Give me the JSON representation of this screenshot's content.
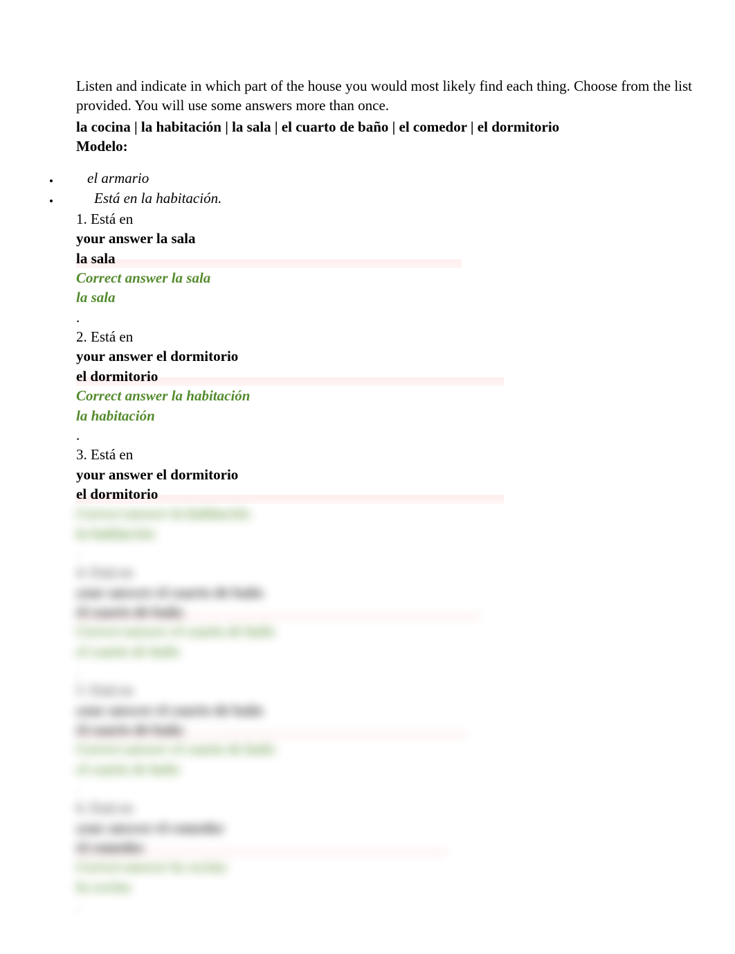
{
  "instructions": "Listen and indicate in which part of the house you would most likely find each thing. Choose from the list provided. You will use some answers more than once.",
  "word_bank": "la cocina | la habitación | la sala | el cuarto de baño | el comedor | el dormitorio",
  "modelo_label": "Modelo:",
  "modelo": {
    "item": "el armario",
    "answer": "Está en la habitación."
  },
  "labels": {
    "your_answer": "your answer",
    "correct_answer": "Correct answer"
  },
  "questions": [
    {
      "num": "1",
      "prompt": "Está en",
      "your_answer": "la sala",
      "correct_answer": "la sala",
      "period": "."
    },
    {
      "num": "2",
      "prompt": "Está en",
      "your_answer": "el dormitorio",
      "correct_answer": "la habitación",
      "period": "."
    },
    {
      "num": "3",
      "prompt": "Está en",
      "your_answer": "el dormitorio",
      "correct_answer": "la habitación",
      "period": "."
    },
    {
      "num": "4",
      "prompt": "Está en",
      "your_answer": "el cuarto de baño",
      "correct_answer": "el cuarto de baño",
      "period": "."
    },
    {
      "num": "5",
      "prompt": "Está en",
      "your_answer": "el cuarto de baño",
      "correct_answer": "el cuarto de baño",
      "period": "."
    },
    {
      "num": "6",
      "prompt": "Está en",
      "your_answer": "el comedor",
      "correct_answer": "la cocina",
      "period": "."
    }
  ]
}
